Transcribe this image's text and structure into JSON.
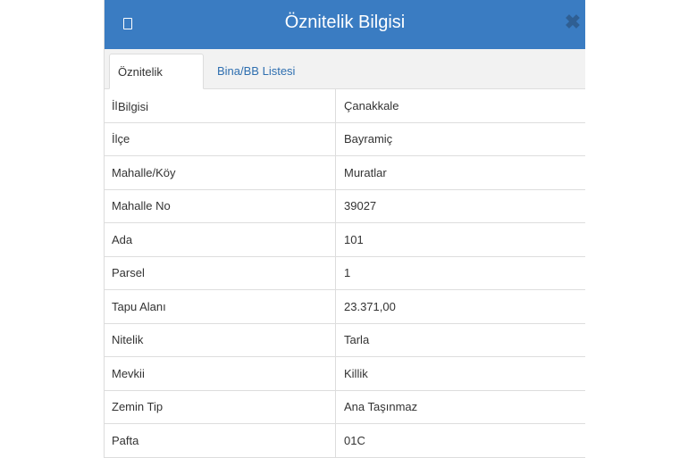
{
  "header": {
    "title": "Öznitelik Bilgisi",
    "close_symbol": "✖",
    "icon": "document-icon"
  },
  "tabs": [
    {
      "label": "Öznitelik Bilgisi",
      "active": true
    },
    {
      "label": "Bina/BB Listesi",
      "active": false
    }
  ],
  "attributes": [
    {
      "key": "İl",
      "value": "Çanakkale"
    },
    {
      "key": "İlçe",
      "value": "Bayramiç"
    },
    {
      "key": "Mahalle/Köy",
      "value": "Muratlar"
    },
    {
      "key": "Mahalle No",
      "value": "39027"
    },
    {
      "key": "Ada",
      "value": "101"
    },
    {
      "key": "Parsel",
      "value": "1"
    },
    {
      "key": "Tapu Alanı",
      "value": "23.371,00"
    },
    {
      "key": "Nitelik",
      "value": "Tarla"
    },
    {
      "key": "Mevkii",
      "value": "Killik"
    },
    {
      "key": "Zemin Tip",
      "value": "Ana Taşınmaz"
    },
    {
      "key": "Pafta",
      "value": "01C"
    }
  ],
  "colors": {
    "header_bg": "#3a7cc2",
    "tab_link": "#2f6fb0",
    "border": "#dddddd"
  }
}
